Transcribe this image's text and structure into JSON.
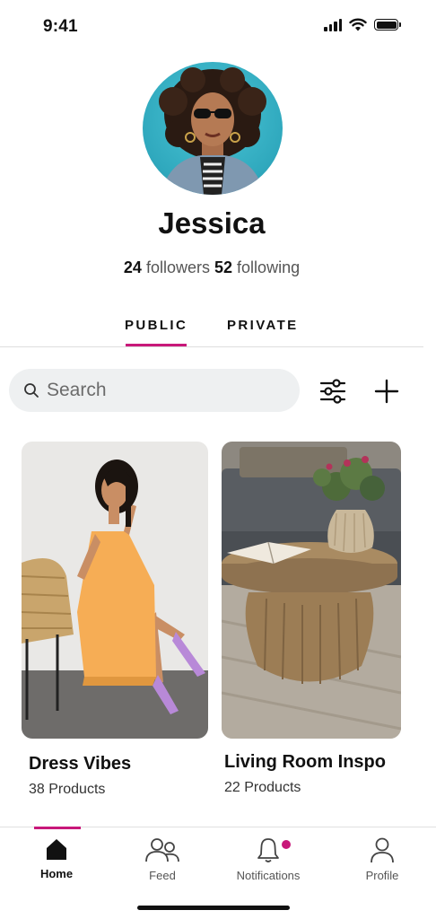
{
  "status_bar": {
    "time": "9:41"
  },
  "profile": {
    "name": "Jessica",
    "followers_count": "24",
    "followers_label": "followers",
    "following_count": "52",
    "following_label": "following"
  },
  "tabs": [
    {
      "label": "PUBLIC",
      "active": true
    },
    {
      "label": "PRIVATE",
      "active": false
    }
  ],
  "search": {
    "placeholder": "Search"
  },
  "toolbar": {
    "filter_icon": "sliders-icon",
    "add_icon": "plus-icon"
  },
  "collections": [
    {
      "title": "Dress Vibes",
      "count": "38 Products"
    },
    {
      "title": "Living Room Inspo",
      "count": "22 Products"
    }
  ],
  "bottom_nav": [
    {
      "label": "Home",
      "icon": "home-icon",
      "active": true
    },
    {
      "label": "Feed",
      "icon": "people-icon",
      "active": false
    },
    {
      "label": "Notifications",
      "icon": "bell-icon",
      "active": false,
      "has_badge": true
    },
    {
      "label": "Profile",
      "icon": "user-icon",
      "active": false
    }
  ],
  "colors": {
    "accent": "#c8187a",
    "search_bg": "#eef0f1"
  }
}
